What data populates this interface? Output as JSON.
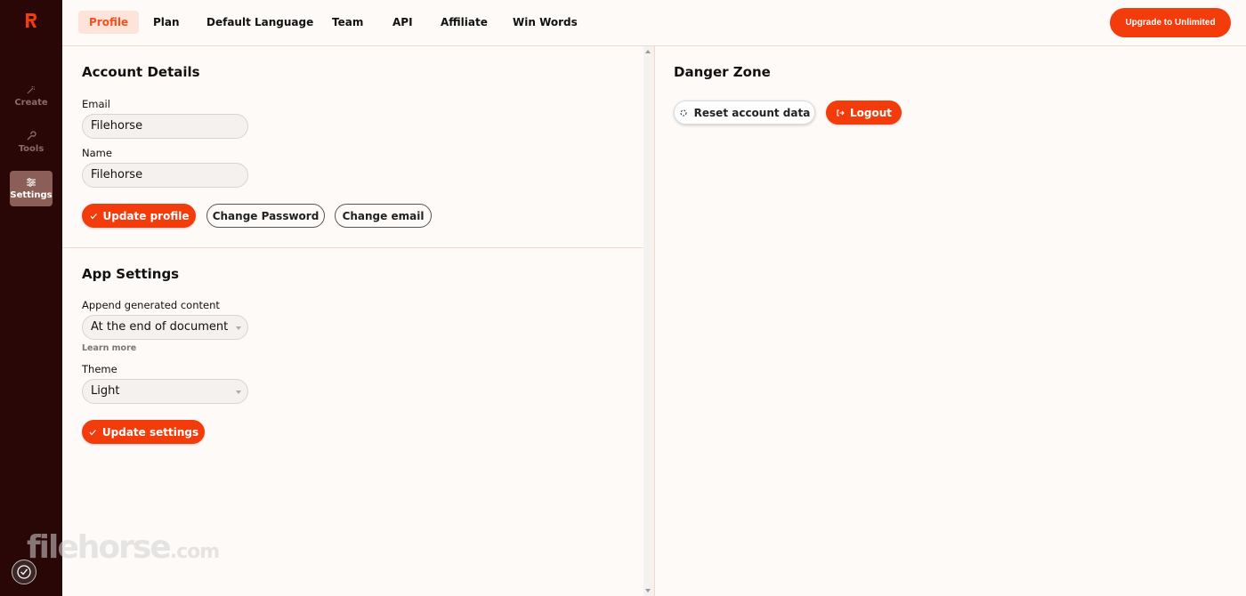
{
  "sidebar": {
    "items": [
      {
        "label": "Create",
        "icon": "wand-icon"
      },
      {
        "label": "Tools",
        "icon": "wrench-icon"
      },
      {
        "label": "Settings",
        "icon": "sliders-icon"
      }
    ]
  },
  "tabs": [
    {
      "label": "Profile"
    },
    {
      "label": "Plan"
    },
    {
      "label": "Default Language"
    },
    {
      "label": "Team"
    },
    {
      "label": "API"
    },
    {
      "label": "Affiliate"
    },
    {
      "label": "Win Words"
    }
  ],
  "upgrade_label": "Upgrade to Unlimited",
  "account": {
    "title": "Account Details",
    "email_label": "Email",
    "email_value": "Filehorse",
    "name_label": "Name",
    "name_value": "Filehorse",
    "update_label": "Update profile",
    "change_password_label": "Change Password",
    "change_email_label": "Change email"
  },
  "app_settings": {
    "title": "App Settings",
    "append_label": "Append generated content",
    "append_value": "At the end of document",
    "learn_more": "Learn more",
    "theme_label": "Theme",
    "theme_value": "Light",
    "update_label": "Update settings"
  },
  "danger": {
    "title": "Danger Zone",
    "reset_label": "Reset account data",
    "logout_label": "Logout"
  },
  "watermark": {
    "main": "filehorse",
    "suffix": ".com"
  },
  "colors": {
    "accent": "#f23c0c",
    "sidebar": "#2a0707",
    "active_tab_bg": "#fde4da"
  }
}
